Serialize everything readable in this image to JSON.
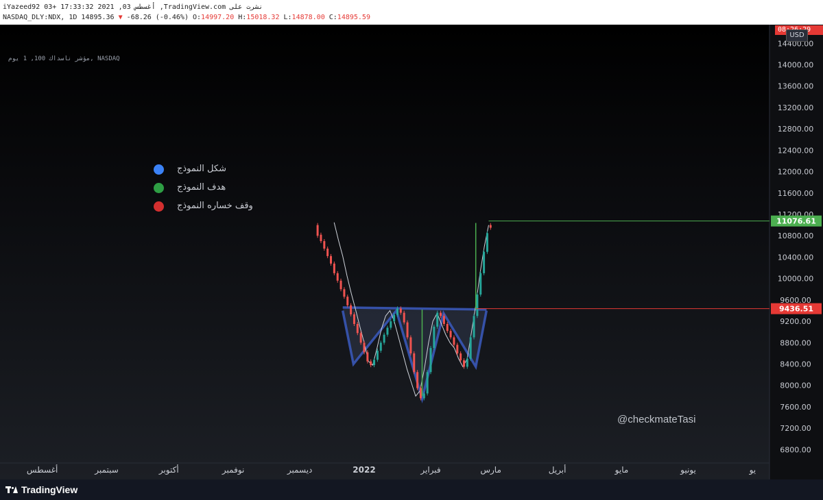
{
  "header": {
    "line1": "iYazeed92 03+ 17:33:32 2021 ,03 أغسطس ,TradingView.com نشرت على",
    "symbol": "NASDAQ_DLY:NDX, 1D 14895.36",
    "change_arrow": "▼",
    "change": "-68.26 (-0.46%)",
    "open_label": "O:",
    "open": "14997.20",
    "high_label": "H:",
    "high": "15018.32",
    "low_label": "L:",
    "low": "14878.00",
    "close_label": "C:",
    "close": "14895.59"
  },
  "symbol_caption": "مؤشر ناسداك 100, 1 يوم, NASDAQ",
  "currency": "USD",
  "top_price_tag": "08:26:29",
  "legend": [
    {
      "label": "شكل النموذج",
      "color": "#3b82f6"
    },
    {
      "label": "هدف النموذج",
      "color": "#2e9e44"
    },
    {
      "label": "وقف خساره النموذج",
      "color": "#d32f2f"
    }
  ],
  "watermark": "@checkmateTasi",
  "footer": {
    "brand": "TradingView"
  },
  "chart_data": {
    "type": "line",
    "title": "",
    "ylim": [
      6600,
      14750
    ],
    "y_ticks": [
      6800,
      7200,
      7600,
      8000,
      8400,
      8800,
      9200,
      9600,
      10000,
      10400,
      10800,
      11200,
      11600,
      12000,
      12400,
      12800,
      13200,
      13600,
      14000,
      14400
    ],
    "y_tick_labels": [
      "6800.00",
      "7200.00",
      "7600.00",
      "8000.00",
      "8400.00",
      "8800.00",
      "9200.00",
      "9600.00",
      "10000.00",
      "10400.00",
      "10800.00",
      "11200.00",
      "11600.00",
      "12000.00",
      "12400.00",
      "12800.00",
      "13200.00",
      "13600.00",
      "14000.00",
      "14400.00"
    ],
    "x_range": [
      -152,
      102
    ],
    "x_ticks": [
      {
        "day": -150,
        "label": "أغسطس"
      },
      {
        "day": -120,
        "label": "سبتمبر"
      },
      {
        "day": -91,
        "label": "أكتوبر"
      },
      {
        "day": -61,
        "label": "نوفمبر"
      },
      {
        "day": -30,
        "label": "ديسمبر"
      },
      {
        "day": 0,
        "label": "2022",
        "bold": true
      },
      {
        "day": 31,
        "label": "فبراير"
      },
      {
        "day": 59,
        "label": "مارس"
      },
      {
        "day": 90,
        "label": "أبريل"
      },
      {
        "day": 120,
        "label": "مايو"
      },
      {
        "day": 151,
        "label": "يونيو"
      },
      {
        "day": 181,
        "label": "يو"
      }
    ],
    "pattern": {
      "name": "شكل النموذج",
      "color": "#3b5bbf",
      "points": [
        [
          -10,
          9400
        ],
        [
          -5,
          8400
        ],
        [
          15,
          9400
        ],
        [
          27,
          7750
        ],
        [
          37,
          9350
        ],
        [
          52,
          8350
        ],
        [
          57,
          9400
        ]
      ],
      "neckline": [
        [
          -10,
          9460
        ],
        [
          57,
          9420
        ]
      ]
    },
    "price_path": [
      [
        -14,
        11050
      ],
      [
        -12,
        10720
      ],
      [
        -10,
        10420
      ],
      [
        -8,
        10050
      ],
      [
        -6,
        9720
      ],
      [
        -4,
        9420
      ],
      [
        -2,
        9100
      ],
      [
        0,
        8800
      ],
      [
        2,
        8450
      ],
      [
        4,
        8380
      ],
      [
        6,
        8700
      ],
      [
        8,
        9050
      ],
      [
        10,
        9300
      ],
      [
        12,
        9400
      ],
      [
        14,
        9200
      ],
      [
        16,
        8900
      ],
      [
        18,
        8600
      ],
      [
        20,
        8300
      ],
      [
        22,
        8050
      ],
      [
        24,
        7800
      ],
      [
        26,
        7900
      ],
      [
        28,
        8300
      ],
      [
        30,
        8800
      ],
      [
        32,
        9200
      ],
      [
        34,
        9350
      ],
      [
        36,
        9150
      ],
      [
        38,
        8950
      ],
      [
        40,
        8800
      ],
      [
        42,
        8700
      ],
      [
        44,
        8500
      ],
      [
        46,
        8350
      ],
      [
        48,
        8500
      ],
      [
        50,
        9000
      ],
      [
        52,
        9500
      ],
      [
        54,
        10100
      ],
      [
        56,
        10600
      ],
      [
        58,
        11000
      ]
    ],
    "candles": [
      {
        "x": -14,
        "o": 11000,
        "c": 10800
      },
      {
        "x": -13,
        "o": 10820,
        "c": 10700
      },
      {
        "x": -12,
        "o": 10700,
        "c": 10560
      },
      {
        "x": -11,
        "o": 10560,
        "c": 10420
      },
      {
        "x": -10,
        "o": 10420,
        "c": 10280
      },
      {
        "x": -9,
        "o": 10280,
        "c": 10100
      },
      {
        "x": -8,
        "o": 10100,
        "c": 9960
      },
      {
        "x": -7,
        "o": 9960,
        "c": 9800
      },
      {
        "x": -6,
        "o": 9800,
        "c": 9660
      },
      {
        "x": -5,
        "o": 9660,
        "c": 9500
      },
      {
        "x": -4,
        "o": 9500,
        "c": 9330
      },
      {
        "x": -3,
        "o": 9330,
        "c": 9150
      },
      {
        "x": -2,
        "o": 9150,
        "c": 8980
      },
      {
        "x": -1,
        "o": 8980,
        "c": 8800
      },
      {
        "x": 0,
        "o": 8800,
        "c": 8620
      },
      {
        "x": 1,
        "o": 8620,
        "c": 8450
      },
      {
        "x": 2,
        "o": 8450,
        "c": 8380
      },
      {
        "x": 3,
        "o": 8380,
        "c": 8480
      },
      {
        "x": 4,
        "o": 8480,
        "c": 8650
      },
      {
        "x": 5,
        "o": 8650,
        "c": 8800
      },
      {
        "x": 6,
        "o": 8800,
        "c": 8950
      },
      {
        "x": 7,
        "o": 8950,
        "c": 9080
      },
      {
        "x": 8,
        "o": 9080,
        "c": 9200
      },
      {
        "x": 9,
        "o": 9200,
        "c": 9320
      },
      {
        "x": 10,
        "o": 9320,
        "c": 9440
      },
      {
        "x": 11,
        "o": 9440,
        "c": 9360
      },
      {
        "x": 12,
        "o": 9360,
        "c": 9180
      },
      {
        "x": 13,
        "o": 9180,
        "c": 8900
      },
      {
        "x": 14,
        "o": 8900,
        "c": 8600
      },
      {
        "x": 15,
        "o": 8600,
        "c": 8250
      },
      {
        "x": 16,
        "o": 8250,
        "c": 7950
      },
      {
        "x": 17,
        "o": 7950,
        "c": 7760
      },
      {
        "x": 18,
        "o": 7760,
        "c": 7850
      },
      {
        "x": 19,
        "o": 7850,
        "c": 8250
      },
      {
        "x": 20,
        "o": 8250,
        "c": 8700
      },
      {
        "x": 21,
        "o": 8700,
        "c": 9100
      },
      {
        "x": 22,
        "o": 9100,
        "c": 9360
      },
      {
        "x": 23,
        "o": 9360,
        "c": 9300
      },
      {
        "x": 24,
        "o": 9300,
        "c": 9150
      },
      {
        "x": 25,
        "o": 9150,
        "c": 9020
      },
      {
        "x": 26,
        "o": 9020,
        "c": 8900
      },
      {
        "x": 27,
        "o": 8900,
        "c": 8760
      },
      {
        "x": 28,
        "o": 8760,
        "c": 8600
      },
      {
        "x": 29,
        "o": 8600,
        "c": 8470
      },
      {
        "x": 30,
        "o": 8470,
        "c": 8350
      },
      {
        "x": 31,
        "o": 8350,
        "c": 8500
      },
      {
        "x": 32,
        "o": 8500,
        "c": 8900
      },
      {
        "x": 33,
        "o": 8900,
        "c": 9300
      },
      {
        "x": 34,
        "o": 9300,
        "c": 9700
      },
      {
        "x": 35,
        "o": 9700,
        "c": 10100
      },
      {
        "x": 36,
        "o": 10100,
        "c": 10500
      },
      {
        "x": 37,
        "o": 10500,
        "c": 10850
      },
      {
        "x": 38,
        "o": 11000,
        "c": 10950
      }
    ],
    "target_line": {
      "name": "هدف النموذج",
      "value": 11076.61,
      "label": "11076.61",
      "color": "#4caf50"
    },
    "stop_line": {
      "name": "وقف خساره النموذج",
      "value": 9436.51,
      "label": "9436.51",
      "color": "#e53935"
    },
    "target_measure": {
      "x": 52,
      "from": 9420,
      "to": 11040
    },
    "depth_measure": {
      "x": 27,
      "from": 9420,
      "to": 7800
    }
  }
}
